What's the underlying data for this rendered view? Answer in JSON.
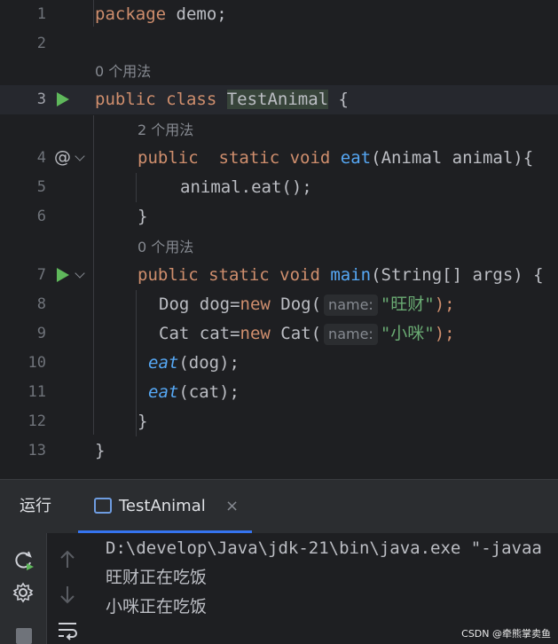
{
  "editor": {
    "lines": [
      {
        "n": "1"
      },
      {
        "n": "2"
      },
      {
        "n": "3"
      },
      {
        "n": "4"
      },
      {
        "n": "5"
      },
      {
        "n": "6"
      },
      {
        "n": "7"
      },
      {
        "n": "8"
      },
      {
        "n": "9"
      },
      {
        "n": "10"
      },
      {
        "n": "11"
      },
      {
        "n": "12"
      },
      {
        "n": "13"
      }
    ],
    "code": {
      "l1_kw": "package",
      "l1_rest": " demo;",
      "hint_class": "0 个用法",
      "l3_kw": "public class ",
      "l3_cls": "TestAnimal",
      "l3_rest": " {",
      "hint_eat": "2 个用法",
      "l4_kw1": "public",
      "l4_kw2": "  static void ",
      "l4_fn": "eat",
      "l4_rest": "(Animal animal){",
      "l5": "animal.eat();",
      "l6": "}",
      "hint_main": "0 个用法",
      "l7_kw": "public static void ",
      "l7_fn": "main",
      "l7_rest": "(String[] args) {",
      "l8_a": "Dog dog=",
      "l8_kw": "new",
      "l8_b": " Dog(",
      "l8_param": "name:",
      "l8_str": "\"旺财\"",
      "l8_end": ");",
      "l9_a": "Cat cat=",
      "l9_kw": "new",
      "l9_b": " Cat(",
      "l9_param": "name:",
      "l9_str": "\"小咪\"",
      "l9_end": ");",
      "l10_fn": "eat",
      "l10_rest": "(dog);",
      "l11_fn": "eat",
      "l11_rest": "(cat);",
      "l12": "}",
      "l13": "}"
    },
    "gutter_icons": {
      "at": "@"
    }
  },
  "run_panel": {
    "title": "运行",
    "tab_label": "TestAnimal",
    "tab_close": "×",
    "output": [
      "D:\\develop\\Java\\jdk-21\\bin\\java.exe \"-javaa",
      "旺财正在吃饭",
      "小咪正在吃饭"
    ]
  },
  "watermark": "CSDN @牵熊掌卖鱼",
  "colors": {
    "accent": "#3574f0",
    "run": "#5fb85b",
    "keyword": "#cf8e6d",
    "string": "#6aab73",
    "function": "#56a8f5"
  }
}
